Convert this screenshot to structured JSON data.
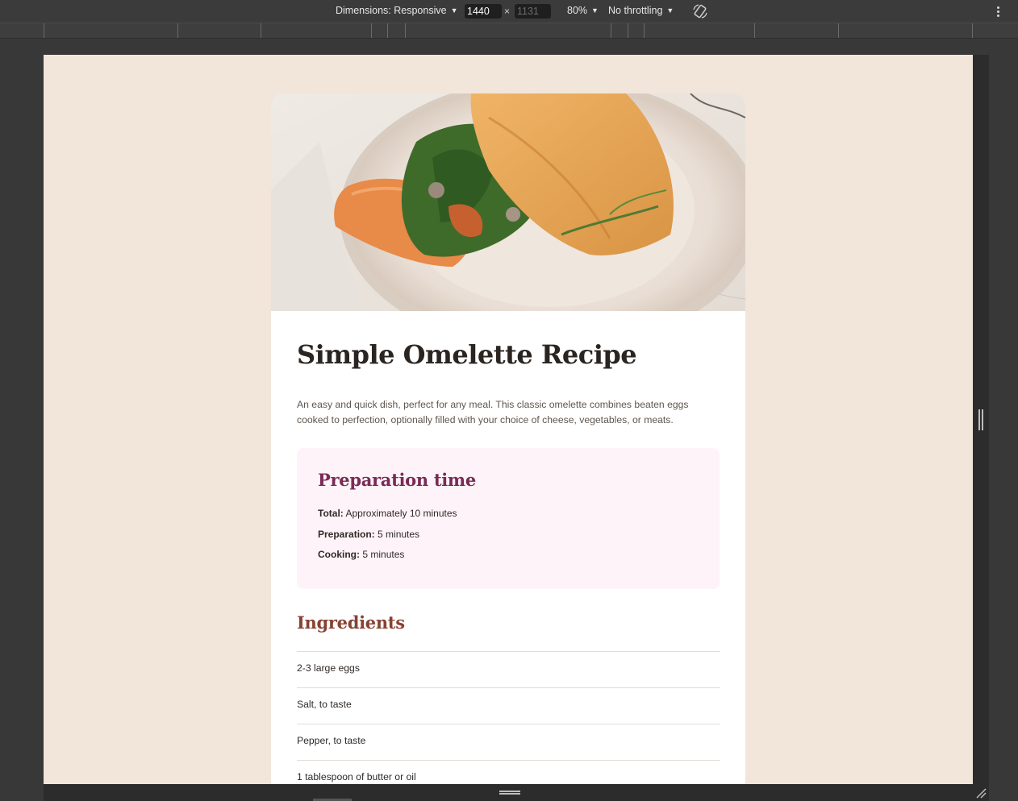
{
  "devtools": {
    "dimensions_label": "Dimensions: Responsive",
    "width_value": "1440",
    "height_placeholder": "1131",
    "times": "×",
    "zoom": "80%",
    "throttling": "No throttling",
    "icons": [
      "chevron-down-icon",
      "rotate-icon",
      "more-vert-icon",
      "resize-handle-icon"
    ]
  },
  "recipe": {
    "title": "Simple Omelette Recipe",
    "intro": "An easy and quick dish, perfect for any meal. This classic omelette combines beaten eggs cooked to perfection, optionally filled with your choice of cheese, vegetables, or meats.",
    "preparation": {
      "heading": "Preparation time",
      "items": [
        {
          "label": "Total:",
          "value": "Approximately 10 minutes"
        },
        {
          "label": "Preparation:",
          "value": "5 minutes"
        },
        {
          "label": "Cooking:",
          "value": "5 minutes"
        }
      ]
    },
    "ingredients": {
      "heading": "Ingredients",
      "items": [
        "2-3 large eggs",
        "Salt, to taste",
        "Pepper, to taste",
        "1 tablespoon of butter or oil"
      ]
    }
  },
  "colors": {
    "page_bg": "#f2e5da",
    "card_bg": "#ffffff",
    "prep_bg": "#fdf3f8",
    "prep_heading": "#7a2a55",
    "ingredients_heading": "#874232",
    "title_text": "#2b2521"
  }
}
